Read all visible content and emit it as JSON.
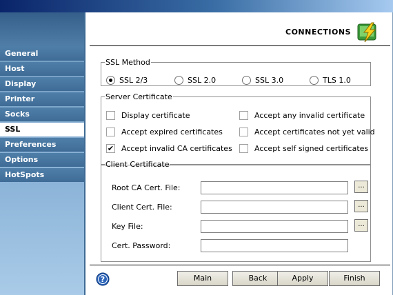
{
  "sidebar": {
    "items": [
      {
        "label": "General",
        "active": false
      },
      {
        "label": "Host",
        "active": false
      },
      {
        "label": "Display",
        "active": false
      },
      {
        "label": "Printer",
        "active": false
      },
      {
        "label": "Socks",
        "active": false
      },
      {
        "label": "SSL",
        "active": true
      },
      {
        "label": "Preferences",
        "active": false
      },
      {
        "label": "Options",
        "active": false
      },
      {
        "label": "HotSpots",
        "active": false
      }
    ]
  },
  "header": {
    "title": "CONNECTIONS",
    "icon": "connections-lightning-icon"
  },
  "ssl_method": {
    "legend": "SSL Method",
    "options": [
      {
        "label": "SSL 2/3",
        "selected": true
      },
      {
        "label": "SSL 2.0",
        "selected": false
      },
      {
        "label": "SSL 3.0",
        "selected": false
      },
      {
        "label": "TLS 1.0",
        "selected": false
      }
    ]
  },
  "server_certificate": {
    "legend": "Server Certificate",
    "options": [
      {
        "label": "Display certificate",
        "checked": false
      },
      {
        "label": "Accept any invalid certificate",
        "checked": false
      },
      {
        "label": "Accept expired certificates",
        "checked": false
      },
      {
        "label": "Accept certificates not yet valid",
        "checked": false
      },
      {
        "label": "Accept invalid CA certificates",
        "checked": true
      },
      {
        "label": "Accept self signed certificates",
        "checked": false
      }
    ]
  },
  "client_certificate": {
    "legend": "Client Certificate",
    "fields": [
      {
        "label": "Root CA Cert. File:",
        "value": "",
        "browse": "..."
      },
      {
        "label": "Client Cert. File:",
        "value": "",
        "browse": "..."
      },
      {
        "label": "Key File:",
        "value": "",
        "browse": "..."
      },
      {
        "label": "Cert. Password:",
        "value": ""
      }
    ]
  },
  "footer": {
    "help_icon": "help-question-icon",
    "buttons": {
      "main": "Main",
      "back": "Back",
      "apply": "Apply",
      "finish": "Finish"
    }
  },
  "colors": {
    "sidebar_item": "#3f6c96",
    "sidebar_active": "#ffffff",
    "accent": "#0a246a"
  }
}
